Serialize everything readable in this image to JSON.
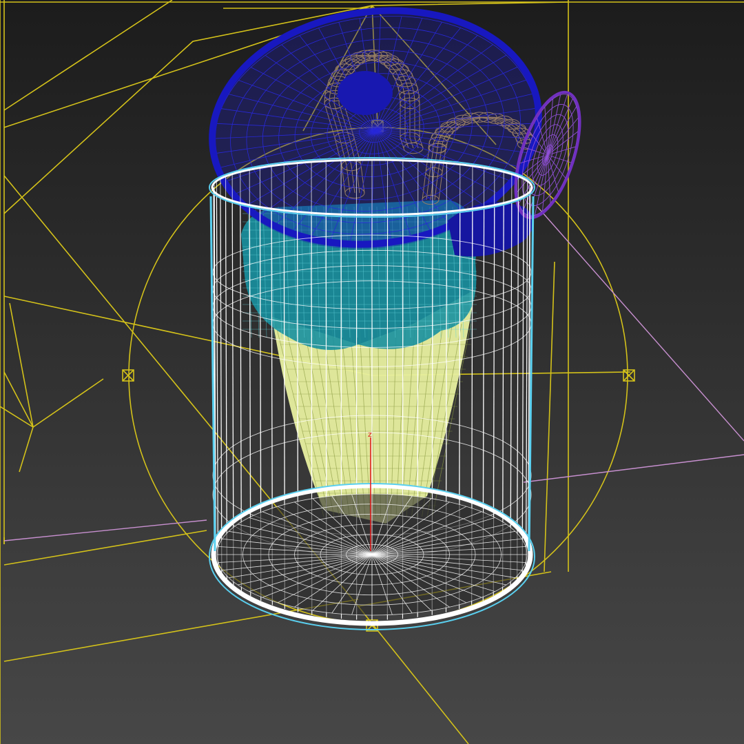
{
  "viewport": {
    "axis_label": "z",
    "colors": {
      "background_top": "#1c1c1c",
      "background_bottom": "#474747",
      "selection_lines": "#d4c21a",
      "light_lines": "#c890d0",
      "cylinder_wire": "#ffffff",
      "cylinder_rim": "#5ad0f0",
      "lid": "#2020c8",
      "handle": "#d8b040",
      "side_ring": "#9050d8",
      "inner_fill": "#e8f0a0",
      "inner_teal": "#1890a0",
      "z_axis": "#e02020"
    },
    "icons": [
      "gizmo-box-icon"
    ]
  }
}
